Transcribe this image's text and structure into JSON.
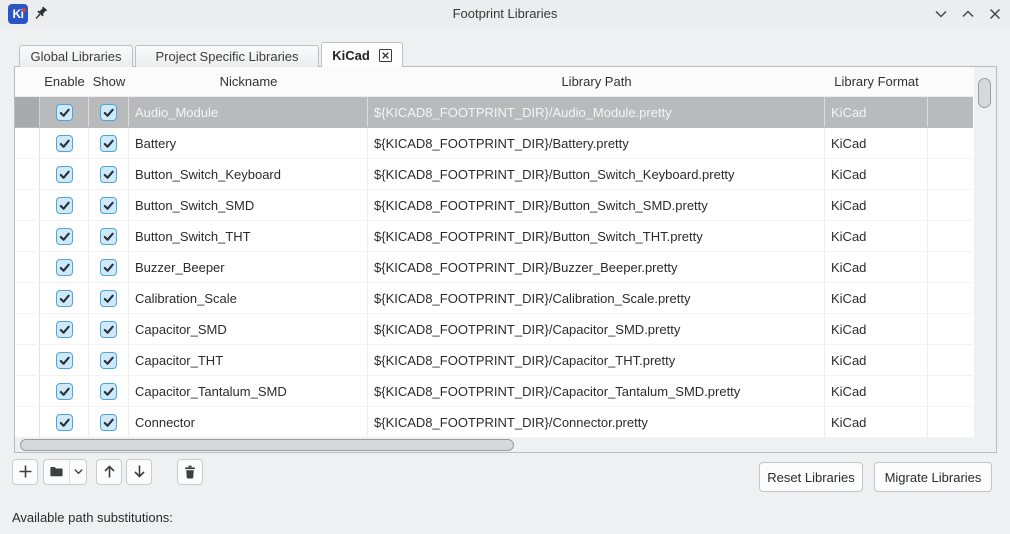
{
  "window": {
    "title": "Footprint Libraries",
    "logo_text": "Ki"
  },
  "tabs": {
    "items": [
      {
        "label": "Global Libraries"
      },
      {
        "label": "Project Specific Libraries"
      },
      {
        "label": "KiCad"
      }
    ],
    "active_index": 2
  },
  "grid": {
    "columns": {
      "enable": "Enable",
      "show": "Show",
      "nickname": "Nickname",
      "library_path": "Library Path",
      "library_format": "Library Format"
    },
    "rows": [
      {
        "enable": true,
        "show": true,
        "nickname": "Audio_Module",
        "library_path": "${KICAD8_FOOTPRINT_DIR}/Audio_Module.pretty",
        "library_format": "KiCad",
        "selected": true
      },
      {
        "enable": true,
        "show": true,
        "nickname": "Battery",
        "library_path": "${KICAD8_FOOTPRINT_DIR}/Battery.pretty",
        "library_format": "KiCad",
        "selected": false
      },
      {
        "enable": true,
        "show": true,
        "nickname": "Button_Switch_Keyboard",
        "library_path": "${KICAD8_FOOTPRINT_DIR}/Button_Switch_Keyboard.pretty",
        "library_format": "KiCad",
        "selected": false
      },
      {
        "enable": true,
        "show": true,
        "nickname": "Button_Switch_SMD",
        "library_path": "${KICAD8_FOOTPRINT_DIR}/Button_Switch_SMD.pretty",
        "library_format": "KiCad",
        "selected": false
      },
      {
        "enable": true,
        "show": true,
        "nickname": "Button_Switch_THT",
        "library_path": "${KICAD8_FOOTPRINT_DIR}/Button_Switch_THT.pretty",
        "library_format": "KiCad",
        "selected": false
      },
      {
        "enable": true,
        "show": true,
        "nickname": "Buzzer_Beeper",
        "library_path": "${KICAD8_FOOTPRINT_DIR}/Buzzer_Beeper.pretty",
        "library_format": "KiCad",
        "selected": false
      },
      {
        "enable": true,
        "show": true,
        "nickname": "Calibration_Scale",
        "library_path": "${KICAD8_FOOTPRINT_DIR}/Calibration_Scale.pretty",
        "library_format": "KiCad",
        "selected": false
      },
      {
        "enable": true,
        "show": true,
        "nickname": "Capacitor_SMD",
        "library_path": "${KICAD8_FOOTPRINT_DIR}/Capacitor_SMD.pretty",
        "library_format": "KiCad",
        "selected": false
      },
      {
        "enable": true,
        "show": true,
        "nickname": "Capacitor_THT",
        "library_path": "${KICAD8_FOOTPRINT_DIR}/Capacitor_THT.pretty",
        "library_format": "KiCad",
        "selected": false
      },
      {
        "enable": true,
        "show": true,
        "nickname": "Capacitor_Tantalum_SMD",
        "library_path": "${KICAD8_FOOTPRINT_DIR}/Capacitor_Tantalum_SMD.pretty",
        "library_format": "KiCad",
        "selected": false
      },
      {
        "enable": true,
        "show": true,
        "nickname": "Connector",
        "library_path": "${KICAD8_FOOTPRINT_DIR}/Connector.pretty",
        "library_format": "KiCad",
        "selected": false
      }
    ]
  },
  "toolbar": {
    "icons": [
      "plus-icon",
      "folder-icon",
      "chevron-down-icon",
      "arrow-up-icon",
      "arrow-down-icon",
      "trash-icon"
    ]
  },
  "actions": {
    "reset_label": "Reset Libraries",
    "migrate_label": "Migrate Libraries"
  },
  "footer": {
    "substitutions_label": "Available path substitutions:"
  },
  "colors": {
    "checkbox_border": "#4fa5d8",
    "checkbox_fill": "#cfe9f9",
    "selected_row_bg": "#b9babb",
    "logo_blue": "#2a55c6",
    "logo_dot_red": "#e03e2d"
  }
}
